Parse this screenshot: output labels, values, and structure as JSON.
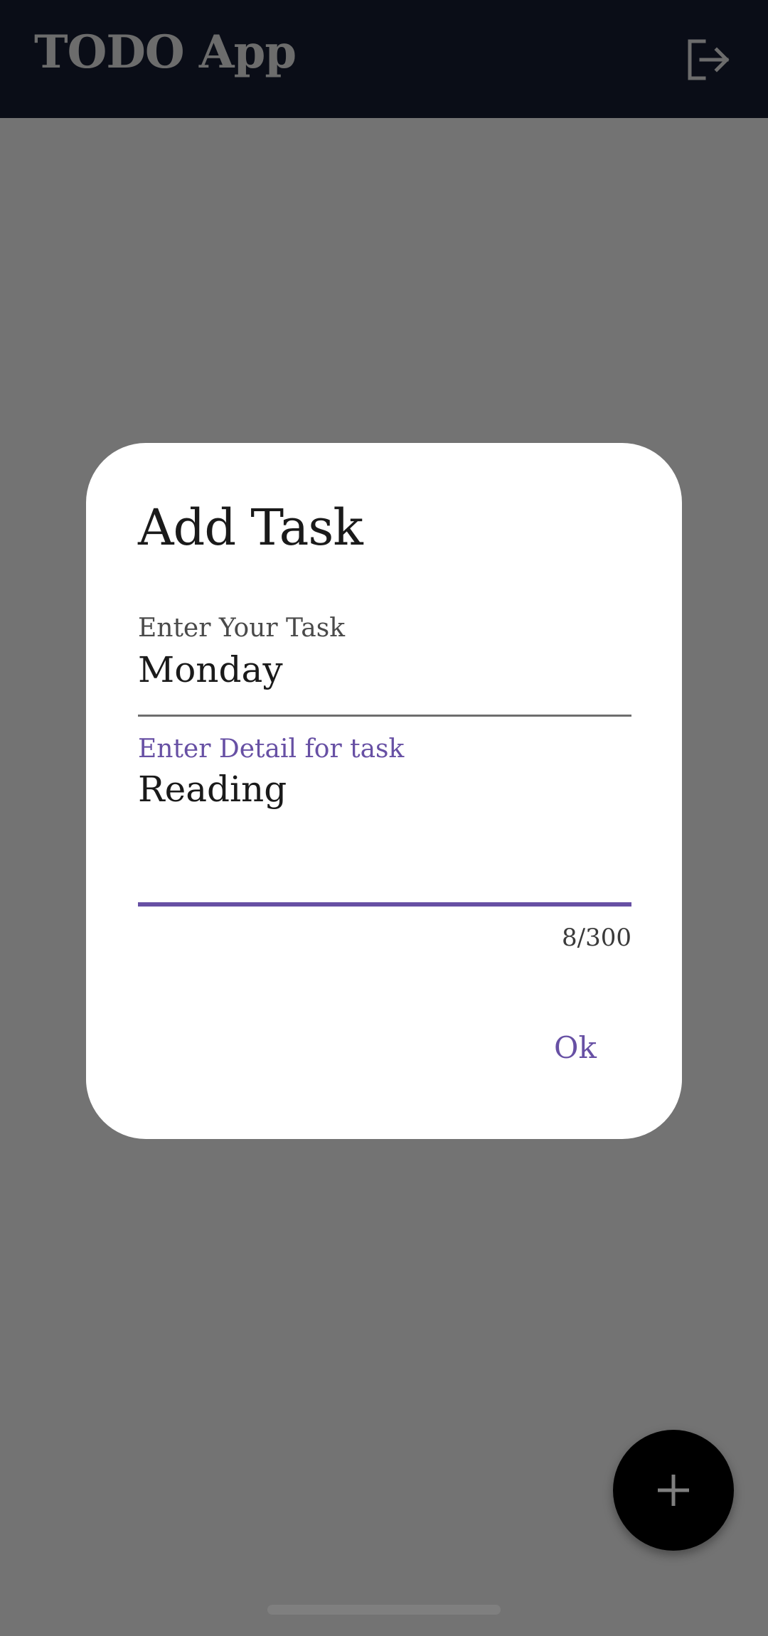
{
  "app_bar": {
    "title": "TODO App",
    "logout_icon": "logout-icon"
  },
  "fab": {
    "icon": "plus-icon"
  },
  "dialog": {
    "title": "Add Task",
    "task_field": {
      "label": "Enter Your Task",
      "value": "Monday"
    },
    "detail_field": {
      "label": "Enter Detail for task",
      "value": "Reading",
      "counter": "8/300"
    },
    "ok_label": "Ok"
  },
  "colors": {
    "accent": "#6750a4",
    "app_bar": "#141a2e",
    "fab": "#000000",
    "scrim": "rgba(0,0,0,0.5)"
  }
}
